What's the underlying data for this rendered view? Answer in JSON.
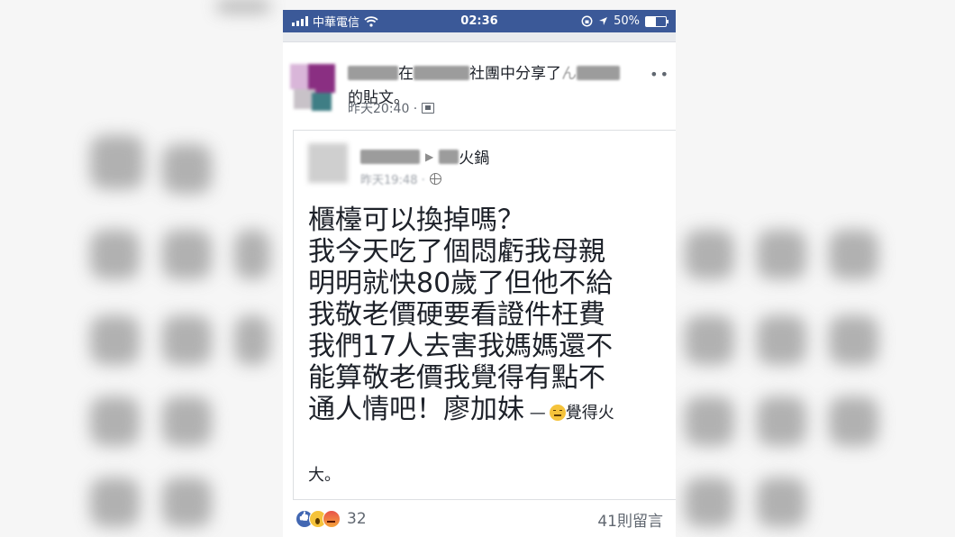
{
  "status_bar": {
    "carrier": "中華電信",
    "time": "02:36",
    "battery": "50%",
    "battery_level": 0.5
  },
  "share": {
    "in_text": "在",
    "group_text": "社團中分享了",
    "tail_char": "ん",
    "post_suffix": "的貼文。",
    "timestamp": "昨天20:40 ·",
    "more": "••"
  },
  "shared_post": {
    "page_suffix": "火鍋",
    "timestamp": "昨天19:48 ·",
    "body": "櫃檯可以換掉嗎？\n我今天吃了個悶虧我母親\n明明就快80歲了但他不給\n我敬老價硬要看證件枉費\n我們17人去害我媽媽還不\n能算敬老價我覺得有點不\n通人情吧！廖加妹",
    "feeling_dash": "—",
    "feeling_text": "覺得火",
    "feeling_tail": "大。"
  },
  "footer": {
    "reaction_count": "32",
    "comment_count": "41則留言"
  },
  "colors": {
    "status_bar": "#3b5998",
    "text": "#1d2129",
    "meta": "#616770"
  },
  "icons": [
    "signal-icon",
    "wifi-icon",
    "orientation-lock-icon",
    "location-arrow-icon",
    "battery-icon",
    "privacy-group-icon",
    "globe-icon",
    "angry-emoji-icon",
    "like-icon",
    "wow-icon",
    "angry-icon"
  ]
}
